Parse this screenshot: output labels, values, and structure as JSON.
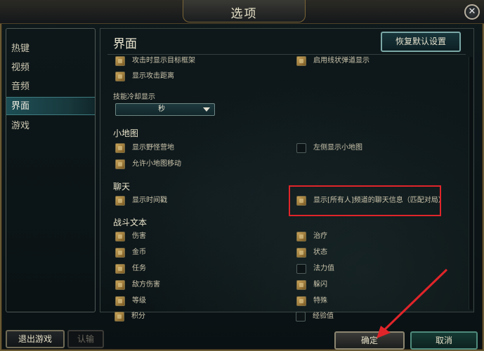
{
  "window": {
    "title": "选项",
    "close_label": "✕"
  },
  "sidebar": {
    "items": [
      {
        "label": "热键",
        "active": false
      },
      {
        "label": "视频",
        "active": false
      },
      {
        "label": "音频",
        "active": false
      },
      {
        "label": "界面",
        "active": true
      },
      {
        "label": "游戏",
        "active": false
      }
    ]
  },
  "main": {
    "title": "界面",
    "restore_label": "恢复默认设置",
    "top_options": {
      "attack_target_frame": {
        "label": "攻击时显示目标框架",
        "checked": true
      },
      "linear_missile": {
        "label": "启用线状弹道显示",
        "checked": true
      },
      "attack_range": {
        "label": "显示攻击距离",
        "checked": true
      }
    },
    "cooldown": {
      "label": "技能冷却显示",
      "value": "秒"
    },
    "minimap": {
      "heading": "小地图",
      "show_camps": {
        "label": "显示野怪营地",
        "checked": true
      },
      "left_side": {
        "label": "左侧显示小地图",
        "checked": false
      },
      "allow_move": {
        "label": "允许小地图移动",
        "checked": true
      }
    },
    "chat": {
      "heading": "聊天",
      "timestamp": {
        "label": "显示时间戳",
        "checked": true
      },
      "all_chat": {
        "label": "显示[所有人]频道的聊天信息（匹配对局）",
        "checked": true
      }
    },
    "combat_text": {
      "heading": "战斗文本",
      "damage": {
        "label": "伤害",
        "checked": true
      },
      "heal": {
        "label": "治疗",
        "checked": true
      },
      "gold": {
        "label": "金币",
        "checked": true
      },
      "status": {
        "label": "状态",
        "checked": true
      },
      "quest": {
        "label": "任务",
        "checked": true
      },
      "mana": {
        "label": "法力值",
        "checked": false
      },
      "enemy_damage": {
        "label": "敌方伤害",
        "checked": true
      },
      "dodge": {
        "label": "躲闪",
        "checked": true
      },
      "level": {
        "label": "等级",
        "checked": true
      },
      "special": {
        "label": "特殊",
        "checked": true
      },
      "score": {
        "label": "积分",
        "checked": true
      },
      "xp": {
        "label": "经验值",
        "checked": false
      }
    }
  },
  "footer": {
    "exit_label": "退出游戏",
    "surrender_label": "认输",
    "ok_label": "确定",
    "cancel_label": "取消"
  },
  "colors": {
    "accent": "#1d4e55",
    "gold": "#c9a45a",
    "annotation": "#e0252a"
  }
}
